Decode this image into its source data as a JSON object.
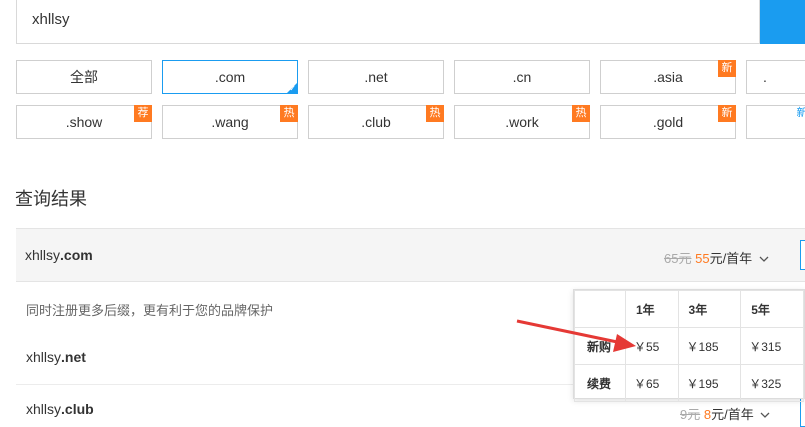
{
  "search": {
    "value": "xhllsy"
  },
  "tlds_row1": [
    {
      "label": "全部",
      "badge": ""
    },
    {
      "label": ".com",
      "badge": "",
      "active": true
    },
    {
      "label": ".net",
      "badge": ""
    },
    {
      "label": ".cn",
      "badge": ""
    },
    {
      "label": ".asia",
      "badge": "新"
    },
    {
      "label": ".",
      "badge": ""
    }
  ],
  "tlds_row2": [
    {
      "label": ".show",
      "badge": "荐"
    },
    {
      "label": ".wang",
      "badge": "热"
    },
    {
      "label": ".club",
      "badge": "热"
    },
    {
      "label": ".work",
      "badge": "热"
    },
    {
      "label": ".gold",
      "badge": "新"
    },
    {
      "label": "",
      "badge": "新"
    }
  ],
  "results_title": "查询结果",
  "main_result": {
    "name": "xhllsy",
    "tld": ".com",
    "old_price": "65元",
    "new_price": "55",
    "unit": "元/首年",
    "chevron": "chevron-down-icon"
  },
  "hint": "同时注册更多后缀，更有利于您的品牌保护",
  "other_results": [
    {
      "name": "xhllsy",
      "tld": ".net"
    },
    {
      "name": "xhllsy",
      "tld": ".club",
      "old_price": "9元",
      "new_price": "8",
      "unit": "元/首年"
    }
  ],
  "price_table": {
    "headers": [
      "",
      "1年",
      "3年",
      "5年"
    ],
    "rows": [
      {
        "label": "新购",
        "values": [
          "￥55",
          "￥185",
          "￥315"
        ]
      },
      {
        "label": "续费",
        "values": [
          "￥65",
          "￥195",
          "￥325"
        ]
      }
    ]
  },
  "colors": {
    "accent": "#1a9cf0",
    "badge": "#ff7a21",
    "arrow": "#e53935"
  }
}
